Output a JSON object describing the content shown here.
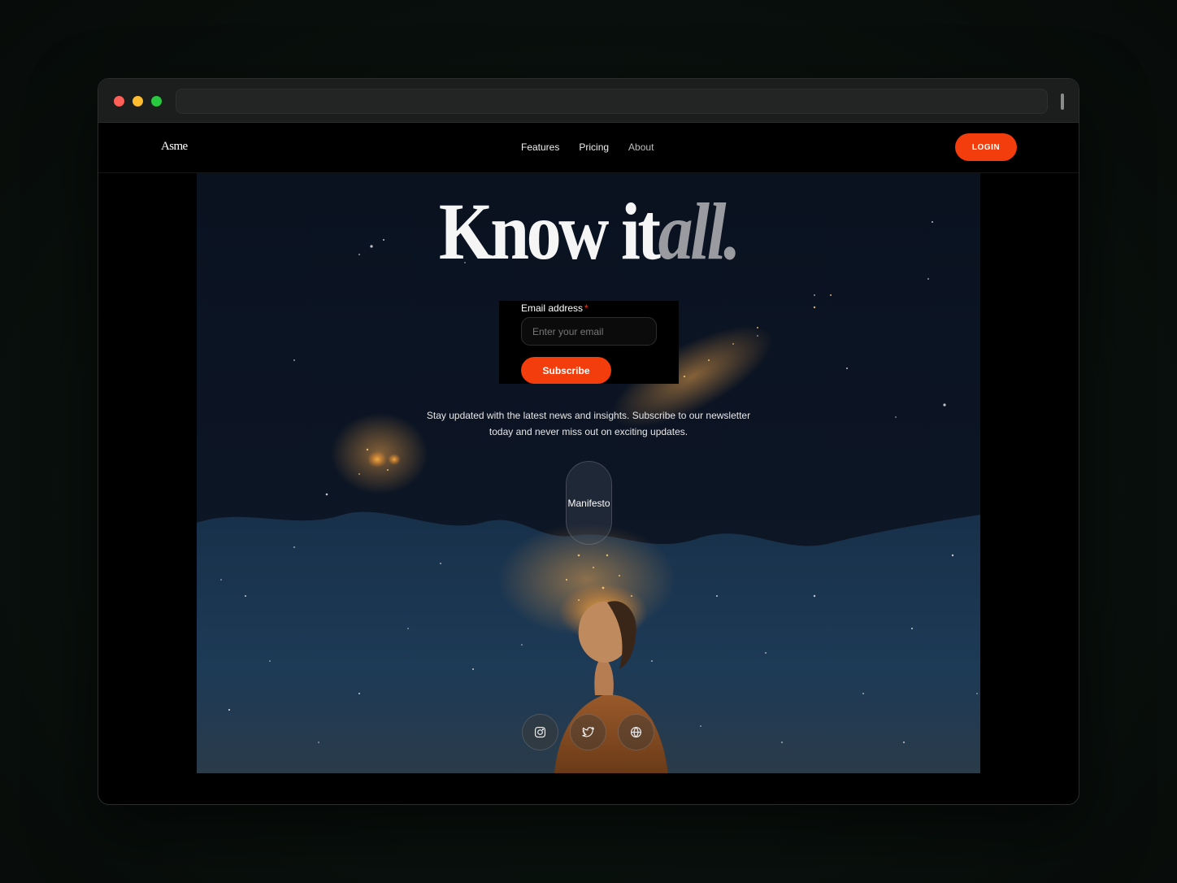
{
  "browser": {
    "traffic_lights": [
      "close-icon",
      "minimize-icon",
      "maximize-icon"
    ],
    "address_value": ""
  },
  "navbar": {
    "logo": "Asme",
    "links": [
      "Features",
      "Pricing",
      "About"
    ],
    "login_label": "LOGIN"
  },
  "hero": {
    "headline_main": "Know it",
    "headline_accent": "all.",
    "email_label": "Email address",
    "required_mark": "*",
    "email_value": "",
    "email_placeholder": "Enter your email",
    "subscribe_label": "Subscribe",
    "description": "Stay updated with the latest news and insights. Subscribe to our newsletter today and never miss out on exciting updates.",
    "manifesto_label": "Manifesto",
    "socials": [
      "instagram-icon",
      "twitter-icon",
      "globe-icon"
    ]
  },
  "colors": {
    "accent": "#f33d0c",
    "background": "#000000",
    "page_background": "#0a120e",
    "headline": "#f5f5f5",
    "headline_accent": "#9a9ba0"
  }
}
